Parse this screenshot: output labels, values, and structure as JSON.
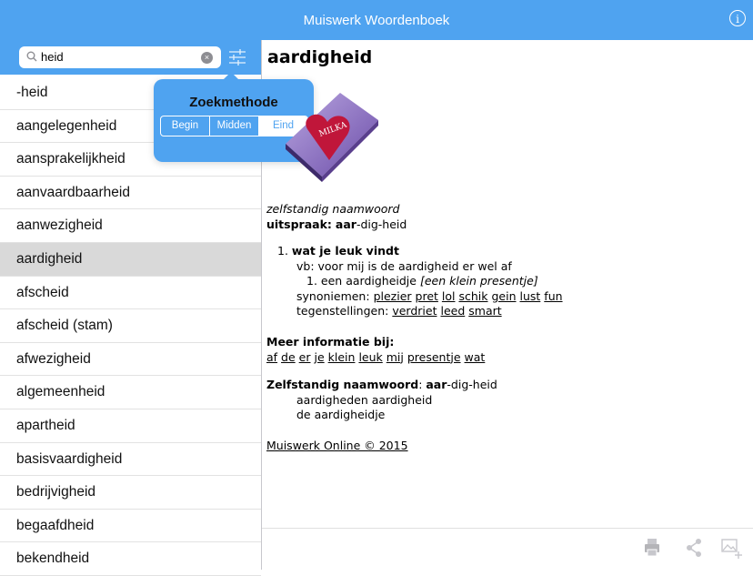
{
  "app": {
    "title": "Muiswerk Woordenboek",
    "info_glyph": "i"
  },
  "search": {
    "value": "heid",
    "clear_glyph": "×"
  },
  "list": [
    "-heid",
    "aangelegenheid",
    "aansprakelijkheid",
    "aanvaardbaarheid",
    "aanwezigheid",
    "aardigheid",
    "afscheid",
    "afscheid (stam)",
    "afwezigheid",
    "algemeenheid",
    "apartheid",
    "basisvaardigheid",
    "bedrijvigheid",
    "begaafdheid",
    "bekendheid"
  ],
  "selected_index": 5,
  "popover": {
    "title": "Zoekmethode",
    "options": [
      "Begin",
      "Midden",
      "Eind"
    ],
    "selected": "Eind"
  },
  "entry": {
    "headword": "aardigheid",
    "image_label": "MILKA",
    "word_type": "zelfstandig naamwoord",
    "pron_label": "uitspraak:",
    "pron_bold": "aar",
    "pron_rest": "-dig-heid",
    "sense_num": "1.",
    "sense_title": "wat je leuk vindt",
    "example": "vb: voor mij is de aardigheid er wel af",
    "sub_num": "1.",
    "sub_text": "een aardigheidje",
    "sub_gloss": "[een klein presentje]",
    "syn_label": "synoniemen:",
    "synonyms": [
      "plezier",
      "pret",
      "lol",
      "schik",
      "gein",
      "lust",
      "fun"
    ],
    "ant_label": "tegenstellingen:",
    "antonyms": [
      "verdriet",
      "leed",
      "smart"
    ],
    "more_title": "Meer informatie bij:",
    "more_links": [
      "af",
      "de",
      "er",
      "je",
      "klein",
      "leuk",
      "mij",
      "presentje",
      "wat"
    ],
    "noun_label": "Zelfstandig naamwoord",
    "noun_bold": "aar",
    "noun_rest": "-dig-heid",
    "forms1": "aardigheden aardigheid",
    "forms2": "de aardigheidje",
    "footer": "Muiswerk Online © 2015"
  },
  "colors": {
    "accent": "#4fa3f0",
    "selected_row": "#d9d9d9"
  },
  "toolbar_icons": [
    "printer-icon",
    "share-icon",
    "add-image-icon"
  ]
}
